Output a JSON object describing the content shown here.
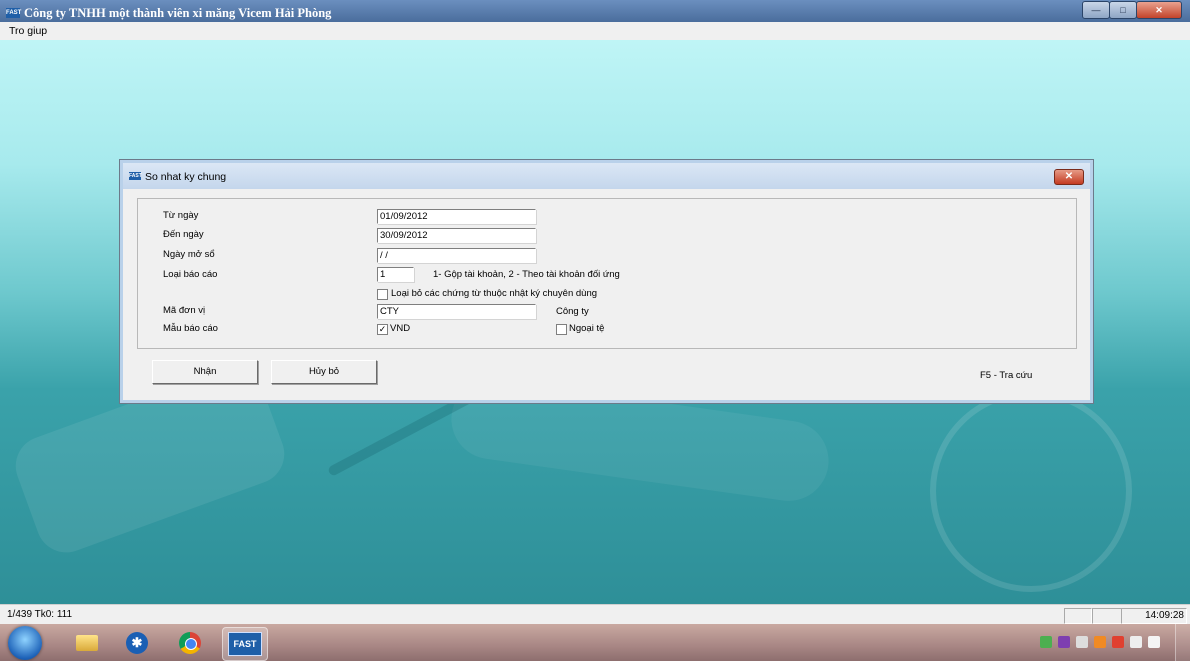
{
  "window": {
    "title": "Công ty TNHH một thành viên xi măng Vicem Hải Phòng",
    "icon": "FAST"
  },
  "menu": {
    "items": [
      "Tro giup"
    ]
  },
  "dialog": {
    "title": "So nhat ky chung",
    "icon": "FAST",
    "close": "✕",
    "fields": {
      "tu_ngay": {
        "label": "Từ ngày",
        "value": "01/09/2012"
      },
      "den_ngay": {
        "label": "Đến ngày",
        "value": "30/09/2012"
      },
      "ngay_mo_so": {
        "label": "Ngày mở sổ",
        "value": " / /"
      },
      "loai_bao_cao": {
        "label": "Loại báo cáo",
        "value": "1",
        "hint": "1- Gộp tài khoản, 2 - Theo tài khoản đối ứng"
      },
      "loai_bo": {
        "label": "Loại bỏ các chứng từ thuộc nhật ký chuyên dùng",
        "checked": false
      },
      "ma_don_vi": {
        "label": "Mã đơn vị",
        "value": "CTY",
        "desc": "Công ty"
      },
      "mau_bao_cao": {
        "label": "Mẫu báo cáo",
        "vnd_label": "VND",
        "vnd_checked": true,
        "ngoai_te_label": "Ngoại tệ",
        "ngoai_te_checked": false
      }
    },
    "buttons": {
      "ok": "Nhận",
      "cancel": "Hủy bỏ"
    },
    "f5_hint": "F5 - Tra cứu"
  },
  "status": {
    "left": "1/439 Tk0: 111",
    "time": "14:09:28"
  },
  "taskbar": {
    "apps": [
      "start-orb",
      "file-explorer",
      "bluetooth",
      "chrome",
      "fast-accounting"
    ],
    "fast_label": "FAST",
    "bt_label": "✱"
  },
  "colors": {
    "workspace": "#a7eaed",
    "dialog_bg": "#f0f0f0",
    "taskbar": "#a88684"
  }
}
